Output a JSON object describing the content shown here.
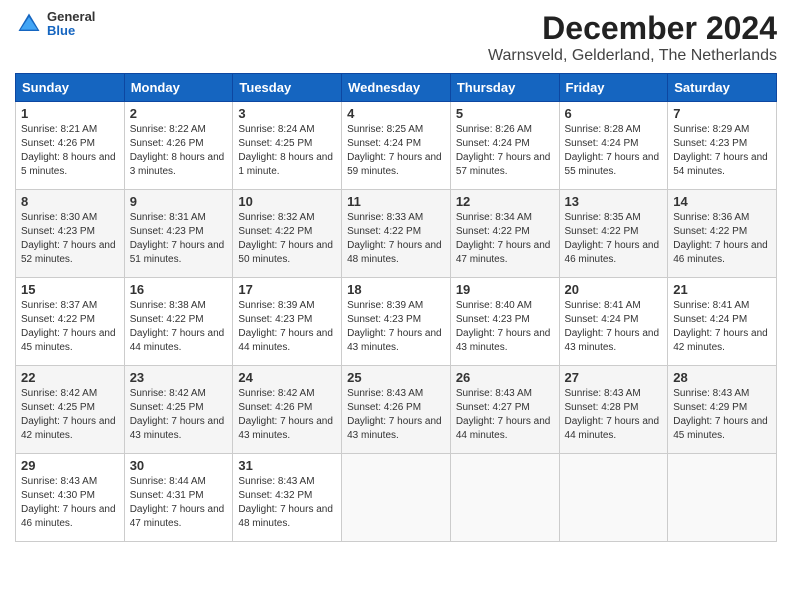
{
  "header": {
    "logo_general": "General",
    "logo_blue": "Blue",
    "main_title": "December 2024",
    "subtitle": "Warnsveld, Gelderland, The Netherlands"
  },
  "calendar": {
    "days_of_week": [
      "Sunday",
      "Monday",
      "Tuesday",
      "Wednesday",
      "Thursday",
      "Friday",
      "Saturday"
    ],
    "weeks": [
      [
        {
          "day": "1",
          "sunrise": "Sunrise: 8:21 AM",
          "sunset": "Sunset: 4:26 PM",
          "daylight": "Daylight: 8 hours and 5 minutes."
        },
        {
          "day": "2",
          "sunrise": "Sunrise: 8:22 AM",
          "sunset": "Sunset: 4:26 PM",
          "daylight": "Daylight: 8 hours and 3 minutes."
        },
        {
          "day": "3",
          "sunrise": "Sunrise: 8:24 AM",
          "sunset": "Sunset: 4:25 PM",
          "daylight": "Daylight: 8 hours and 1 minute."
        },
        {
          "day": "4",
          "sunrise": "Sunrise: 8:25 AM",
          "sunset": "Sunset: 4:24 PM",
          "daylight": "Daylight: 7 hours and 59 minutes."
        },
        {
          "day": "5",
          "sunrise": "Sunrise: 8:26 AM",
          "sunset": "Sunset: 4:24 PM",
          "daylight": "Daylight: 7 hours and 57 minutes."
        },
        {
          "day": "6",
          "sunrise": "Sunrise: 8:28 AM",
          "sunset": "Sunset: 4:24 PM",
          "daylight": "Daylight: 7 hours and 55 minutes."
        },
        {
          "day": "7",
          "sunrise": "Sunrise: 8:29 AM",
          "sunset": "Sunset: 4:23 PM",
          "daylight": "Daylight: 7 hours and 54 minutes."
        }
      ],
      [
        {
          "day": "8",
          "sunrise": "Sunrise: 8:30 AM",
          "sunset": "Sunset: 4:23 PM",
          "daylight": "Daylight: 7 hours and 52 minutes."
        },
        {
          "day": "9",
          "sunrise": "Sunrise: 8:31 AM",
          "sunset": "Sunset: 4:23 PM",
          "daylight": "Daylight: 7 hours and 51 minutes."
        },
        {
          "day": "10",
          "sunrise": "Sunrise: 8:32 AM",
          "sunset": "Sunset: 4:22 PM",
          "daylight": "Daylight: 7 hours and 50 minutes."
        },
        {
          "day": "11",
          "sunrise": "Sunrise: 8:33 AM",
          "sunset": "Sunset: 4:22 PM",
          "daylight": "Daylight: 7 hours and 48 minutes."
        },
        {
          "day": "12",
          "sunrise": "Sunrise: 8:34 AM",
          "sunset": "Sunset: 4:22 PM",
          "daylight": "Daylight: 7 hours and 47 minutes."
        },
        {
          "day": "13",
          "sunrise": "Sunrise: 8:35 AM",
          "sunset": "Sunset: 4:22 PM",
          "daylight": "Daylight: 7 hours and 46 minutes."
        },
        {
          "day": "14",
          "sunrise": "Sunrise: 8:36 AM",
          "sunset": "Sunset: 4:22 PM",
          "daylight": "Daylight: 7 hours and 46 minutes."
        }
      ],
      [
        {
          "day": "15",
          "sunrise": "Sunrise: 8:37 AM",
          "sunset": "Sunset: 4:22 PM",
          "daylight": "Daylight: 7 hours and 45 minutes."
        },
        {
          "day": "16",
          "sunrise": "Sunrise: 8:38 AM",
          "sunset": "Sunset: 4:22 PM",
          "daylight": "Daylight: 7 hours and 44 minutes."
        },
        {
          "day": "17",
          "sunrise": "Sunrise: 8:39 AM",
          "sunset": "Sunset: 4:23 PM",
          "daylight": "Daylight: 7 hours and 44 minutes."
        },
        {
          "day": "18",
          "sunrise": "Sunrise: 8:39 AM",
          "sunset": "Sunset: 4:23 PM",
          "daylight": "Daylight: 7 hours and 43 minutes."
        },
        {
          "day": "19",
          "sunrise": "Sunrise: 8:40 AM",
          "sunset": "Sunset: 4:23 PM",
          "daylight": "Daylight: 7 hours and 43 minutes."
        },
        {
          "day": "20",
          "sunrise": "Sunrise: 8:41 AM",
          "sunset": "Sunset: 4:24 PM",
          "daylight": "Daylight: 7 hours and 43 minutes."
        },
        {
          "day": "21",
          "sunrise": "Sunrise: 8:41 AM",
          "sunset": "Sunset: 4:24 PM",
          "daylight": "Daylight: 7 hours and 42 minutes."
        }
      ],
      [
        {
          "day": "22",
          "sunrise": "Sunrise: 8:42 AM",
          "sunset": "Sunset: 4:25 PM",
          "daylight": "Daylight: 7 hours and 42 minutes."
        },
        {
          "day": "23",
          "sunrise": "Sunrise: 8:42 AM",
          "sunset": "Sunset: 4:25 PM",
          "daylight": "Daylight: 7 hours and 43 minutes."
        },
        {
          "day": "24",
          "sunrise": "Sunrise: 8:42 AM",
          "sunset": "Sunset: 4:26 PM",
          "daylight": "Daylight: 7 hours and 43 minutes."
        },
        {
          "day": "25",
          "sunrise": "Sunrise: 8:43 AM",
          "sunset": "Sunset: 4:26 PM",
          "daylight": "Daylight: 7 hours and 43 minutes."
        },
        {
          "day": "26",
          "sunrise": "Sunrise: 8:43 AM",
          "sunset": "Sunset: 4:27 PM",
          "daylight": "Daylight: 7 hours and 44 minutes."
        },
        {
          "day": "27",
          "sunrise": "Sunrise: 8:43 AM",
          "sunset": "Sunset: 4:28 PM",
          "daylight": "Daylight: 7 hours and 44 minutes."
        },
        {
          "day": "28",
          "sunrise": "Sunrise: 8:43 AM",
          "sunset": "Sunset: 4:29 PM",
          "daylight": "Daylight: 7 hours and 45 minutes."
        }
      ],
      [
        {
          "day": "29",
          "sunrise": "Sunrise: 8:43 AM",
          "sunset": "Sunset: 4:30 PM",
          "daylight": "Daylight: 7 hours and 46 minutes."
        },
        {
          "day": "30",
          "sunrise": "Sunrise: 8:44 AM",
          "sunset": "Sunset: 4:31 PM",
          "daylight": "Daylight: 7 hours and 47 minutes."
        },
        {
          "day": "31",
          "sunrise": "Sunrise: 8:43 AM",
          "sunset": "Sunset: 4:32 PM",
          "daylight": "Daylight: 7 hours and 48 minutes."
        },
        null,
        null,
        null,
        null
      ]
    ]
  }
}
